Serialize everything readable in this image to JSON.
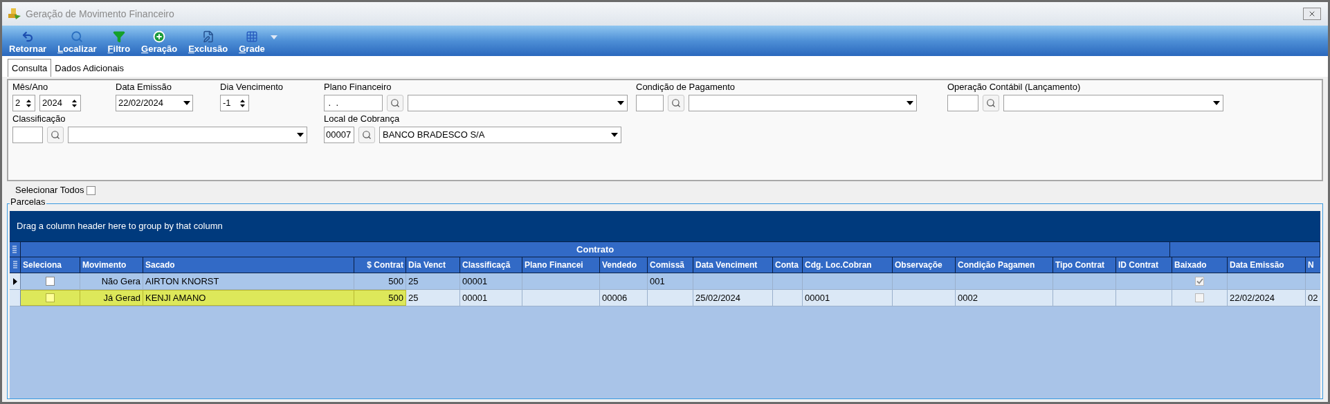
{
  "window": {
    "title": "Geração de Movimento Financeiro"
  },
  "toolbar": [
    {
      "label": "Retornar",
      "accelerator": false
    },
    {
      "label": "Localizar",
      "accelerator": true
    },
    {
      "label": "Filtro",
      "accelerator": true
    },
    {
      "label": "Geração",
      "accelerator": true
    },
    {
      "label": "Exclusão",
      "accelerator": true
    },
    {
      "label": "Grade",
      "accelerator": true
    }
  ],
  "tabs": [
    {
      "label": "Consulta",
      "selected": true
    },
    {
      "label": "Dados Adicionais",
      "selected": false
    }
  ],
  "form": {
    "mes_ano": {
      "label": "Mês/Ano",
      "month": "2",
      "year": "2024"
    },
    "data_emissao": {
      "label": "Data Emissão",
      "value": "22/02/2024"
    },
    "dia_vencimento": {
      "label": "Dia Vencimento",
      "value": "-1"
    },
    "plano_financeiro": {
      "label": "Plano Financeiro",
      "code": " .  ."
    },
    "condicao_pagamento": {
      "label": "Condição de Pagamento"
    },
    "operacao_contabil": {
      "label": "Operação Contábil (Lançamento)"
    },
    "classificacao": {
      "label": "Classificação"
    },
    "local_cobranca": {
      "label": "Local de Cobrança",
      "code": "00007",
      "value": "BANCO BRADESCO S/A"
    }
  },
  "select_all": {
    "label": "Selecionar Todos",
    "checked": false
  },
  "parcelas": {
    "title": "Parcelas",
    "group_hint": "Drag a column header here to group by that column",
    "bands": [
      {
        "label": "Contrato"
      }
    ],
    "columns": [
      {
        "label": "Seleciona",
        "kind": "check"
      },
      {
        "label": "Movimento",
        "kind": "right"
      },
      {
        "label": "Sacado",
        "kind": "text"
      },
      {
        "label": "$ Contrat",
        "kind": "right"
      },
      {
        "label": "Dia Venct",
        "kind": "text"
      },
      {
        "label": "Classificaçã",
        "kind": "text"
      },
      {
        "label": "Plano Financei",
        "kind": "text"
      },
      {
        "label": "Vendedo",
        "kind": "text"
      },
      {
        "label": "Comissã",
        "kind": "text"
      },
      {
        "label": "Data Venciment",
        "kind": "text"
      },
      {
        "label": "Conta",
        "kind": "text"
      },
      {
        "label": "Cdg. Loc.Cobran",
        "kind": "text"
      },
      {
        "label": "Observaçõe",
        "kind": "text"
      },
      {
        "label": "Condição Pagamen",
        "kind": "text"
      },
      {
        "label": "Tipo Contrat",
        "kind": "text"
      },
      {
        "label": "ID Contrat",
        "kind": "text"
      },
      {
        "label": "Baixado",
        "kind": "check"
      },
      {
        "label": "Data Emissão",
        "kind": "text"
      },
      {
        "label": "N",
        "kind": "text"
      }
    ],
    "rows": [
      {
        "current": true,
        "selected": false,
        "cells": [
          {
            "checked": false
          },
          {
            "text": "Não Gera"
          },
          {
            "text": "AIRTON KNORST"
          },
          {
            "text": "500"
          },
          {
            "text": "25"
          },
          {
            "text": "00001"
          },
          {},
          {},
          {
            "text": "001"
          },
          {},
          {},
          {},
          {},
          {},
          {},
          {},
          {
            "checked": true
          },
          {},
          {}
        ]
      },
      {
        "current": false,
        "selected": true,
        "cells": [
          {
            "checked": false
          },
          {
            "text": "Já Gerad"
          },
          {
            "text": "KENJI AMANO"
          },
          {
            "text": "500"
          },
          {
            "text": "25"
          },
          {
            "text": "00001"
          },
          {},
          {
            "text": "00006"
          },
          {},
          {
            "text": "25/02/2024"
          },
          {},
          {
            "text": "00001"
          },
          {},
          {
            "text": "0002"
          },
          {},
          {},
          {
            "checked": false
          },
          {
            "text": "22/02/2024"
          },
          {
            "text": "02"
          }
        ]
      }
    ]
  }
}
